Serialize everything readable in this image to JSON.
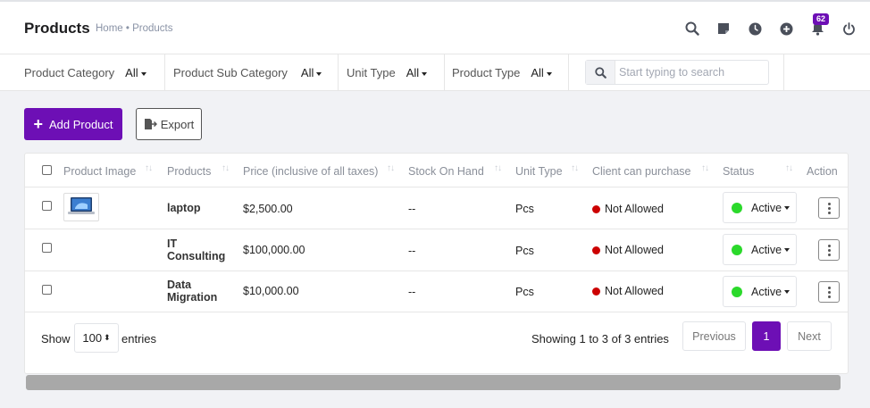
{
  "header": {
    "title": "Products",
    "breadcrumb": "Home • Products",
    "notifications_count": "62"
  },
  "filters": [
    {
      "label": "Product Category",
      "value": "All"
    },
    {
      "label": "Product Sub Category",
      "value": "All"
    },
    {
      "label": "Unit Type",
      "value": "All"
    },
    {
      "label": "Product Type",
      "value": "All"
    }
  ],
  "search": {
    "placeholder": "Start typing to search",
    "value": ""
  },
  "actions": {
    "add_label": "Add Product",
    "export_label": "Export"
  },
  "table": {
    "columns": [
      "Product Image",
      "Products",
      "Price (inclusive of all taxes)",
      "Stock On Hand",
      "Unit Type",
      "Client can purchase",
      "Status",
      "Action"
    ],
    "rows": [
      {
        "image": "laptop",
        "product": "laptop",
        "price": "$2,500.00",
        "stock": "--",
        "unit": "Pcs",
        "client": "Not Allowed",
        "status": "Active"
      },
      {
        "image": "",
        "product": "IT Consulting",
        "price": "$100,000.00",
        "stock": "--",
        "unit": "Pcs",
        "client": "Not Allowed",
        "status": "Active"
      },
      {
        "image": "",
        "product": "Data Migration",
        "price": "$10,000.00",
        "stock": "--",
        "unit": "Pcs",
        "client": "Not Allowed",
        "status": "Active"
      }
    ]
  },
  "footer": {
    "show_label": "Show",
    "page_size": "100",
    "entries_label": "entries",
    "showing_text": "Showing 1 to 3 of 3 entries",
    "previous": "Previous",
    "current_page": "1",
    "next": "Next"
  },
  "colors": {
    "accent": "#6d0fb5",
    "active_dot": "#2bd92b",
    "not_allowed_dot": "#cc0000"
  }
}
